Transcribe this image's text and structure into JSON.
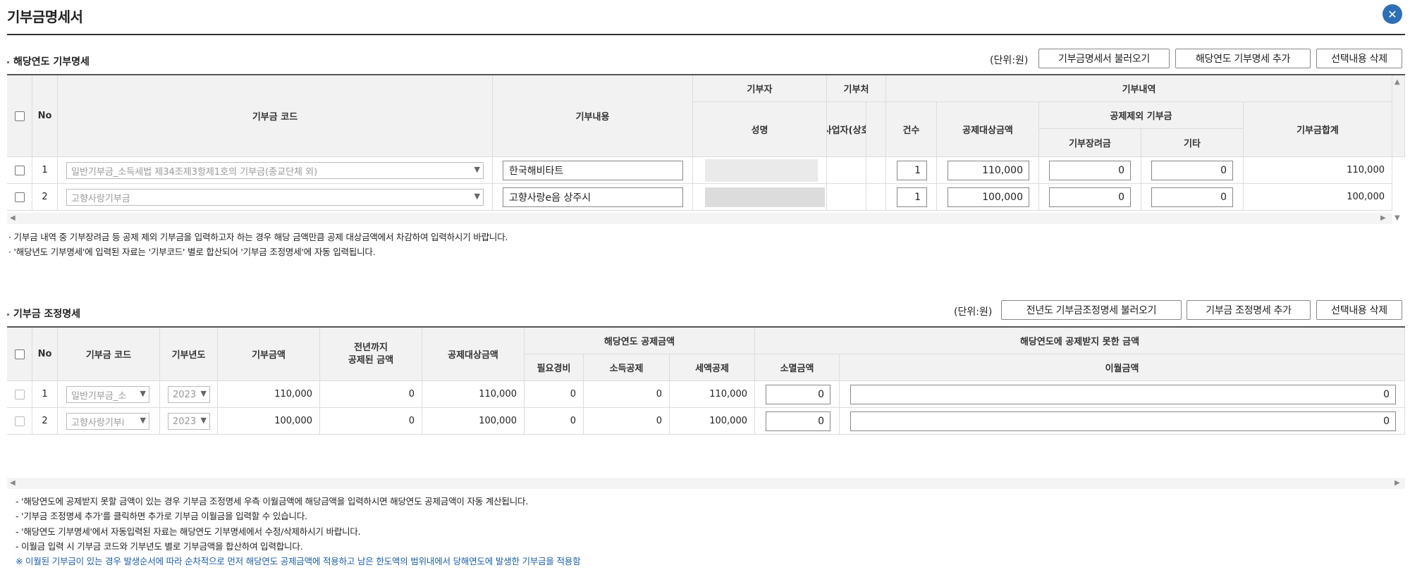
{
  "window": {
    "title": "기부금명세서"
  },
  "section1": {
    "title": "해당연도 기부명세",
    "unit": "(단위:원)",
    "buttons": {
      "load": "기부금명세서 불러오기",
      "add": "해당연도 기부명세 추가",
      "delete": "선택내용 삭제"
    },
    "headers": {
      "no": "No",
      "code": "기부금 코드",
      "content": "기부내용",
      "donor": "기부자",
      "recipient": "기부처",
      "details": "기부내역",
      "name": "성명",
      "bizno": "사업자(상호",
      "count": "건수",
      "deductible": "공제대상금액",
      "excluded": "공제제외 기부금",
      "scholarship": "기부장려금",
      "other": "기타",
      "total": "기부금합계"
    },
    "rows": [
      {
        "no": "1",
        "code": "일반기부금_소득세법 제34조제3항제1호의 기부금(종교단체 외)",
        "content": "한국해비타트",
        "count": "1",
        "deductible": "110,000",
        "scholarship": "0",
        "other": "0",
        "total": "110,000"
      },
      {
        "no": "2",
        "code": "고향사랑기부금",
        "content": "고향사랑e음 상주시",
        "count": "1",
        "deductible": "100,000",
        "scholarship": "0",
        "other": "0",
        "total": "100,000"
      }
    ],
    "notes": [
      "· 기부금 내역 중 기부장려금 등 공제 제외 기부금을 입력하고자 하는 경우 해당 금액만큼 공제 대상금액에서 차감하여 입력하시기 바랍니다.",
      "· '해당년도 기부명세'에 입력된 자료는 '기부코드' 별로 합산되어 '기부금 조정명세'에 자동 입력됩니다."
    ]
  },
  "section2": {
    "title": "기부금 조정명세",
    "unit": "(단위:원)",
    "buttons": {
      "load": "전년도 기부금조정명세 불러오기",
      "add": "기부금 조정명세 추가",
      "delete": "선택내용 삭제"
    },
    "headers": {
      "no": "No",
      "code": "기부금 코드",
      "year": "기부년도",
      "amount": "기부금액",
      "prior": "전년까지\n공제된 금액",
      "deductible": "공제대상금액",
      "current": "해당연도 공제금액",
      "expense": "필요경비",
      "income": "소득공제",
      "tax": "세액공제",
      "notdeducted": "해당연도에 공제받지 못한 금액",
      "extinct": "소멸금액",
      "carry": "이월금액"
    },
    "rows": [
      {
        "no": "1",
        "code": "일반기부금_소",
        "year": "2023",
        "amount": "110,000",
        "prior": "0",
        "deductible": "110,000",
        "expense": "0",
        "income": "0",
        "tax": "110,000",
        "extinct": "0",
        "carry": "0"
      },
      {
        "no": "2",
        "code": "고향사랑기부i",
        "year": "2023",
        "amount": "100,000",
        "prior": "0",
        "deductible": "100,000",
        "expense": "0",
        "income": "0",
        "tax": "100,000",
        "extinct": "0",
        "carry": "0"
      }
    ],
    "notes": [
      "- '해당연도에 공제받지 못할 금액이 있는 경우 기부금 조정명세 우측 이월금액에 해당금액을 입력하시면 해당연도 공제금액이 자동 계산됩니다.",
      "- '기부금 조정명세 추가'를 클릭하면 추가로 기부금 이월금을 입력할 수 있습니다.",
      "- '해당연도 기부명세'에서 자동입력된 자료는 해당연도 기부명세에서 수정/삭제하시기 바랍니다.",
      "- 이월금 입력 시 기부금 코드와 기부년도 별로 기부금액을 합산하여 입력합니다."
    ],
    "blue_note": "※ 이월된 기부금이 있는 경우 발생순서에 따라 순차적으로 먼저 해당연도 공제금액에 적용하고 남은 한도액의 범위내에서 당해연도에 발생한 기부금을 적용함"
  },
  "colors": {
    "accent": "#2e6fb5",
    "blue_note": "#1d5ea8",
    "header_bg": "#f2f2f2"
  }
}
